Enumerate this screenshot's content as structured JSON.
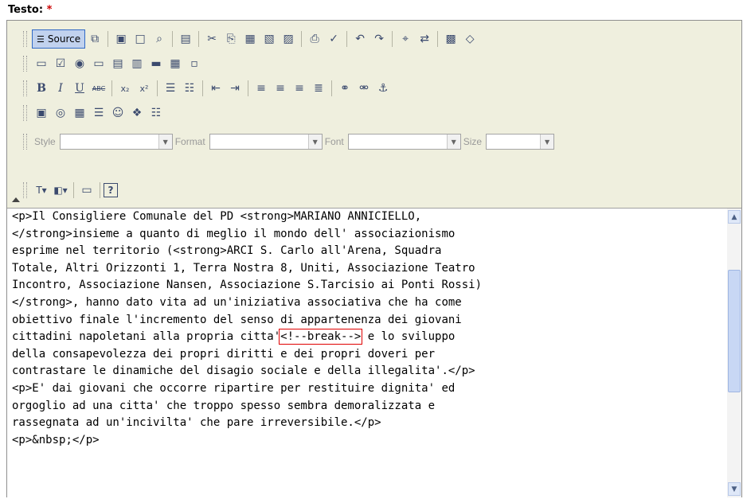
{
  "field": {
    "label": "Testo:",
    "required_mark": "*"
  },
  "toolbar": {
    "source_label": "Source",
    "icons_row1": [
      "templates-icon",
      "save-icon",
      "new-page-icon",
      "preview-icon",
      "document-icon",
      "cut-icon",
      "copy-icon",
      "paste-icon",
      "paste-text-icon",
      "paste-word-icon",
      "print-icon",
      "spellcheck-icon",
      "undo-icon",
      "redo-icon",
      "find-icon",
      "replace-icon",
      "select-all-icon",
      "remove-format-icon"
    ],
    "icons_row2": [
      "form-icon",
      "checkbox-icon",
      "radio-icon",
      "text-field-icon",
      "textarea-icon",
      "select-field-icon",
      "button-icon",
      "image-button-icon",
      "hidden-field-icon"
    ],
    "format_row": {
      "bold": "B",
      "italic": "I",
      "underline": "U",
      "strike": "ABC",
      "subscript": "x₂",
      "superscript": "x²"
    },
    "combos": {
      "style": "Style",
      "format": "Format",
      "font": "Font",
      "size": "Size"
    }
  },
  "content": {
    "lines": [
      "<p>Il Consigliere Comunale del PD <strong>MARIANO ANNICIELLO,",
      "</strong>insieme a quanto di meglio il mondo dell' associazionismo",
      "esprime nel territorio (<strong>ARCI S. Carlo all'Arena, Squadra",
      "Totale, Altri Orizzonti 1, Terra Nostra 8, Uniti, Associazione Teatro",
      "Incontro, Associazione Nansen, Associazione S.Tarcisio ai Ponti Rossi)",
      "</strong>, hanno dato vita ad un'iniziativa associativa che ha come",
      "obiettivo finale l'incremento del senso di appartenenza dei giovani",
      "cittadini napoletani alla propria citta'",
      "della consapevolezza dei propri diritti e dei propri doveri per",
      "contrastare le dinamiche del disagio sociale e della illegalita'.</p>",
      "<p>E' dai giovani che occorre ripartire per restituire dignita' ed",
      "orgoglio ad una citta' che troppo spesso sembra demoralizzata e",
      "rassegnata ad un'incivilta' che pare irreversibile.</p>",
      "<p>&nbsp;</p>"
    ],
    "break_tag": "<!--break-->",
    "line8_tail": " e lo sviluppo"
  },
  "colors": {
    "toolbar_bg": "#efefde",
    "required": "#cc0000",
    "highlight": "#e00000"
  }
}
